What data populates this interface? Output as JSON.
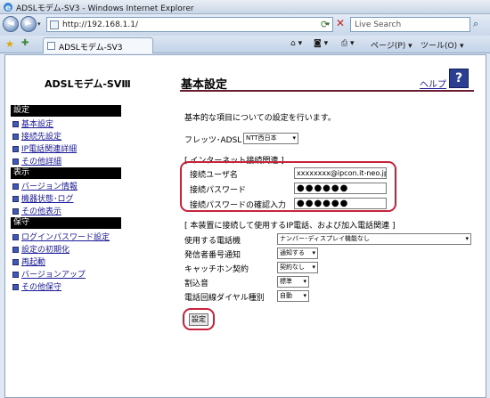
{
  "window": {
    "title": "ADSLモデム-SV3 - Windows Internet Explorer"
  },
  "address": {
    "url": "http://192.168.1.1/",
    "search_placeholder": "Live Search"
  },
  "tab": {
    "label": "ADSLモデム-SV3"
  },
  "toolbar": {
    "page_menu": "ページ(P) ▾",
    "tools_menu": "ツール(O) ▾"
  },
  "leftnav": {
    "brand": "ADSLモデム-SVⅢ",
    "sections": [
      {
        "header": "設定",
        "items": [
          "基本設定",
          "接続先設定",
          "IP電話関連詳細",
          "その他詳細"
        ]
      },
      {
        "header": "表示",
        "items": [
          "バージョン情報",
          "機器状態･ログ",
          "その他表示"
        ]
      },
      {
        "header": "保守",
        "items": [
          "ログインパスワード設定",
          "設定の初期化",
          "再起動",
          "バージョンアップ",
          "その他保守"
        ]
      }
    ]
  },
  "main": {
    "title": "基本設定",
    "help_label": "ヘルプ",
    "intro": "基本的な項目についての設定を行います。",
    "flets_label": "フレッツ･ADSL",
    "flets_value": "NTT西日本",
    "internet_group": "[ インターネット接続関連 ]",
    "user_label": "接続ユーザ名",
    "user_value": "xxxxxxxx@ipcon.it-neo.jp",
    "pass_label": "接続パスワード",
    "pass_value": "●●●●●●",
    "pass_confirm_label": "接続パスワードの確認入力",
    "pass_confirm_value": "●●●●●●",
    "ip_group": "[ 本装置に接続して使用するIP電話、および加入電話関連 ]",
    "phone_label": "使用する電話機",
    "phone_value": "ナンバー･ディスプレイ機能なし",
    "caller_label": "発信者番号通知",
    "caller_value": "通知する",
    "catch_label": "キャッチホン契約",
    "catch_value": "契約なし",
    "ring_label": "割込音",
    "ring_value": "標準",
    "dial_label": "電話回線ダイヤル種別",
    "dial_value": "自動",
    "submit": "設定"
  }
}
